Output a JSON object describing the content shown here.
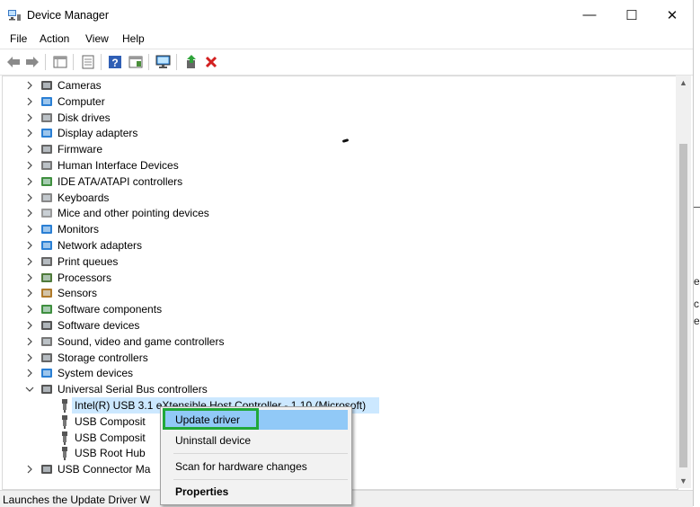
{
  "window": {
    "title": "Device Manager",
    "controls": {
      "minimize": "—",
      "maximize": "☐",
      "close": "✕"
    }
  },
  "menu": [
    "File",
    "Action",
    "View",
    "Help"
  ],
  "toolbar": {
    "buttons": [
      "back-icon",
      "forward-icon",
      "properties-grid-icon",
      "show-hidden-icon",
      "help-icon",
      "view-icon",
      "monitor-scan-icon",
      "update-driver-icon",
      "uninstall-icon"
    ]
  },
  "tree": {
    "items": [
      {
        "label": "Cameras",
        "icon": "camera-icon"
      },
      {
        "label": "Computer",
        "icon": "computer-icon"
      },
      {
        "label": "Disk drives",
        "icon": "disk-drive-icon"
      },
      {
        "label": "Display adapters",
        "icon": "display-adapter-icon"
      },
      {
        "label": "Firmware",
        "icon": "firmware-icon"
      },
      {
        "label": "Human Interface Devices",
        "icon": "hid-icon"
      },
      {
        "label": "IDE ATA/ATAPI controllers",
        "icon": "ide-controller-icon"
      },
      {
        "label": "Keyboards",
        "icon": "keyboard-icon"
      },
      {
        "label": "Mice and other pointing devices",
        "icon": "mouse-icon"
      },
      {
        "label": "Monitors",
        "icon": "monitor-icon"
      },
      {
        "label": "Network adapters",
        "icon": "network-adapter-icon"
      },
      {
        "label": "Print queues",
        "icon": "printer-icon"
      },
      {
        "label": "Processors",
        "icon": "processor-icon"
      },
      {
        "label": "Sensors",
        "icon": "sensor-icon"
      },
      {
        "label": "Software components",
        "icon": "software-component-icon"
      },
      {
        "label": "Software devices",
        "icon": "software-device-icon"
      },
      {
        "label": "Sound, video and game controllers",
        "icon": "speaker-icon"
      },
      {
        "label": "Storage controllers",
        "icon": "storage-controller-icon"
      },
      {
        "label": "System devices",
        "icon": "system-device-icon"
      },
      {
        "label": "Universal Serial Bus controllers",
        "icon": "usb-controller-icon",
        "expanded": true
      }
    ],
    "usb_children": [
      {
        "label": "Intel(R) USB 3.1 eXtensible Host Controller - 1.10 (Microsoft)",
        "selected": true
      },
      {
        "label": "USB Composit"
      },
      {
        "label": "USB Composit"
      },
      {
        "label": "USB Root Hub"
      }
    ],
    "last_item": {
      "label": "USB Connector Ma"
    }
  },
  "context_menu": {
    "items": [
      "Update driver",
      "Uninstall device",
      "Scan for hardware changes",
      "Properties"
    ],
    "highlighted": "Update driver"
  },
  "status_bar": {
    "text": "Launches the Update Driver W"
  },
  "background_fragments": [
    "e",
    "c",
    "e"
  ],
  "colors": {
    "selection": "#cce8ff",
    "menu_highlight": "#91c9f7",
    "annotation_box": "#20a839",
    "close_red": "#d32020"
  }
}
